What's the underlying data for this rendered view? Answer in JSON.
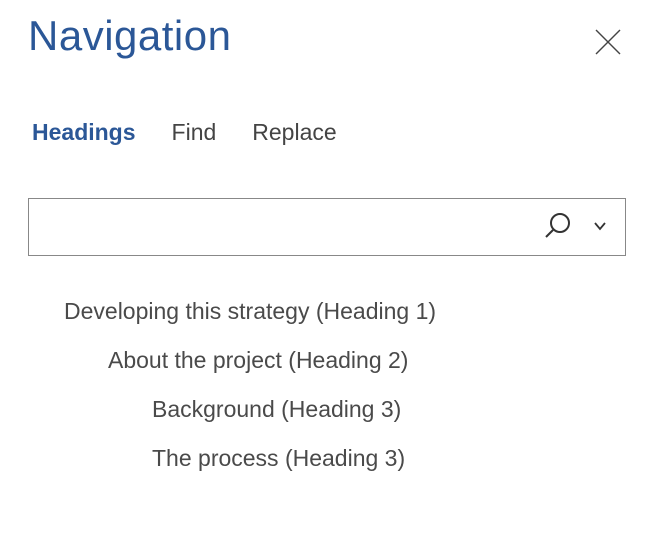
{
  "title": "Navigation",
  "tabs": {
    "headings": "Headings",
    "find": "Find",
    "replace": "Replace"
  },
  "search": {
    "value": "",
    "placeholder": ""
  },
  "headings": [
    {
      "label": "Developing this strategy (Heading 1)",
      "level": 1
    },
    {
      "label": "About the project (Heading 2)",
      "level": 2
    },
    {
      "label": "Background (Heading 3)",
      "level": 3
    },
    {
      "label": "The process (Heading 3)",
      "level": 3
    }
  ]
}
